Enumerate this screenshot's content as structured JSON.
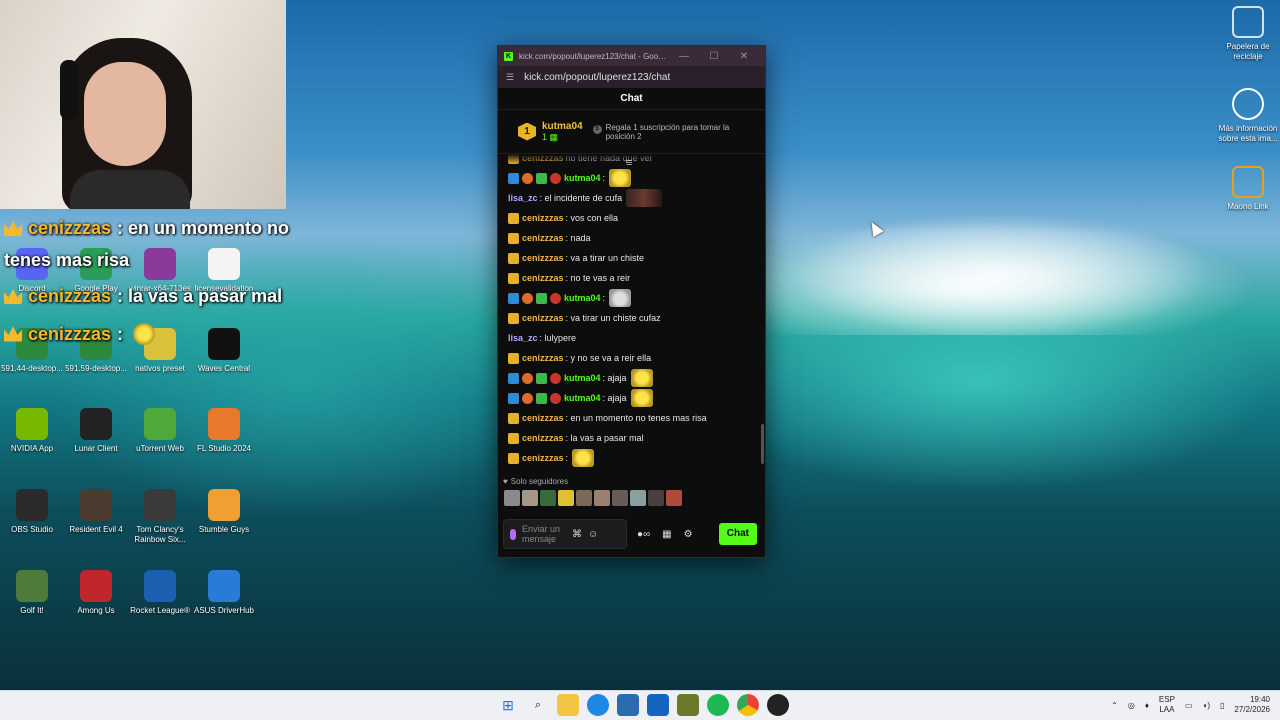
{
  "overlay": {
    "lines": [
      {
        "user": "cenizzzas",
        "text": ": en un momento no"
      },
      {
        "user": "",
        "text": "tenes mas risa"
      },
      {
        "user": "cenizzzas",
        "text": ": la vas a pasar mal"
      },
      {
        "user": "cenizzzas",
        "text": ":"
      }
    ]
  },
  "desktop": {
    "icons_left": [
      {
        "label": "Discord",
        "icon": "discord-icon",
        "color": "#5865f2"
      },
      {
        "label": "Google Play",
        "icon": "google-play-icon",
        "color": "#2a9d5a"
      },
      {
        "label": "winrar-x64-713es",
        "icon": "winrar-icon",
        "color": "#8a3a9a"
      },
      {
        "label": "licensevalidation",
        "icon": "file-icon",
        "color": "#f4f4f4"
      },
      {
        "label": "591.44-desktop...",
        "icon": "nvidia-installer-icon",
        "color": "#2b8a3e"
      },
      {
        "label": "591.59-desktop...",
        "icon": "nvidia-installer-icon",
        "color": "#2b8a3e"
      },
      {
        "label": "nativos preset",
        "icon": "preset-icon",
        "color": "#d9c23a"
      },
      {
        "label": "Waves Central",
        "icon": "waves-icon",
        "color": "#111111"
      },
      {
        "label": "NVIDIA App",
        "icon": "nvidia-icon",
        "color": "#76b900"
      },
      {
        "label": "Lunar Client",
        "icon": "lunar-icon",
        "color": "#222222"
      },
      {
        "label": "uTorrent Web",
        "icon": "utorrent-icon",
        "color": "#4fa83a"
      },
      {
        "label": "FL Studio 2024",
        "icon": "fl-studio-icon",
        "color": "#e8792a"
      },
      {
        "label": "OBS Studio",
        "icon": "obs-icon",
        "color": "#2b2b2b"
      },
      {
        "label": "Resident Evil 4",
        "icon": "re4-icon",
        "color": "#4a3a30"
      },
      {
        "label": "Tom Clancy's Rainbow Six...",
        "icon": "r6-icon",
        "color": "#3a3a3a"
      },
      {
        "label": "Stumble Guys",
        "icon": "stumble-icon",
        "color": "#f0a030"
      },
      {
        "label": "Golf It!",
        "icon": "golf-icon",
        "color": "#4e7a3a"
      },
      {
        "label": "Among Us",
        "icon": "among-us-icon",
        "color": "#c0272d"
      },
      {
        "label": "Rocket League®",
        "icon": "rocket-league-icon",
        "color": "#1d5fb0"
      },
      {
        "label": "ASUS DriverHub",
        "icon": "asus-icon",
        "color": "#2a7ad8"
      }
    ],
    "icons_right": [
      {
        "label": "Papelera de reciclaje",
        "icon": "recycle-bin-icon",
        "color": "#cfe3f0"
      },
      {
        "label": "Más información sobre esta ima...",
        "icon": "info-icon",
        "color": "#ffffff"
      },
      {
        "label": "Maono Link",
        "icon": "maono-icon",
        "color": "#e8a21a"
      }
    ]
  },
  "window": {
    "title": "kick.com/popout/luperez123/chat - Google...",
    "url": "kick.com/popout/luperez123/chat",
    "chat_title": "Chat",
    "leader": {
      "rank": "1",
      "user": "kutma04",
      "count": "1",
      "info": "Regala 1 suscripción para tomar la posición 2"
    },
    "messages": [
      {
        "user": "cenizzzas",
        "type": "cen",
        "text": "no tiene nada que ver",
        "emote": ""
      },
      {
        "user": "kutma04",
        "type": "kut",
        "text": ":",
        "emote": "e-yellow"
      },
      {
        "user": "lisa_zc",
        "type": "lisa",
        "text": ": el incidente de cufa",
        "emote": "e-dark"
      },
      {
        "user": "cenizzzas",
        "type": "cen",
        "text": ": vos con ella",
        "emote": ""
      },
      {
        "user": "cenizzzas",
        "type": "cen",
        "text": ": nada",
        "emote": ""
      },
      {
        "user": "cenizzzas",
        "type": "cen",
        "text": ": va a tirar un chiste",
        "emote": ""
      },
      {
        "user": "cenizzzas",
        "type": "cen",
        "text": ": no te vas a reir",
        "emote": ""
      },
      {
        "user": "kutma04",
        "type": "kut",
        "text": ":",
        "emote": "e-cat"
      },
      {
        "user": "cenizzzas",
        "type": "cen",
        "text": ": va tirar un chiste cufaz",
        "emote": ""
      },
      {
        "user": "lisa_zc",
        "type": "lisa",
        "text": ": lulypere",
        "emote": ""
      },
      {
        "user": "cenizzzas",
        "type": "cen",
        "text": ": y no se va a reir ella",
        "emote": ""
      },
      {
        "user": "kutma04",
        "type": "kut",
        "text": ": ajaja",
        "emote": "e-yellow"
      },
      {
        "user": "kutma04",
        "type": "kut",
        "text": ": ajaja",
        "emote": "e-yellow"
      },
      {
        "user": "cenizzzas",
        "type": "cen",
        "text": ": en un momento no tenes mas risa",
        "emote": ""
      },
      {
        "user": "cenizzzas",
        "type": "cen",
        "text": ": la vas a pasar mal",
        "emote": ""
      },
      {
        "user": "cenizzzas",
        "type": "cen",
        "text": ":",
        "emote": "e-yellow"
      }
    ],
    "followers_only": "Solo seguidores",
    "input_placeholder": "Enviar un mensaje",
    "send_label": "Chat"
  },
  "taskbar": {
    "lang_top": "ESP",
    "lang_bottom": "LAA",
    "time": "19:40",
    "date": "27/2/2026"
  }
}
